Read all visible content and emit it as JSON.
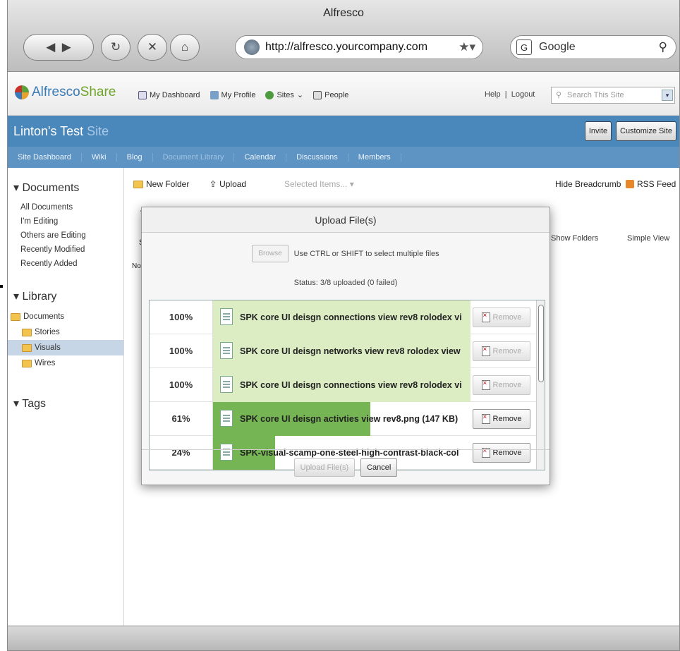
{
  "window": {
    "title": "Alfresco"
  },
  "browser": {
    "url": "http://alfresco.yourcompany.com",
    "search_engine_label": "G",
    "search_placeholder": "Google"
  },
  "app": {
    "logo_part1": "Alfresco ",
    "logo_part2": "Share",
    "top_links": [
      "My Dashboard",
      "My Profile",
      "Sites",
      "People"
    ],
    "help": "Help",
    "logout": "Logout",
    "site_search_placeholder": "Search This Site"
  },
  "site": {
    "title_main": "Linton's Test ",
    "title_suffix": "Site",
    "invite": "Invite",
    "customize": "Customize Site",
    "nav": [
      "Site Dashboard",
      "Wiki",
      "Blog",
      "Document Library",
      "Calendar",
      "Discussions",
      "Members"
    ],
    "active_nav": "Document Library"
  },
  "sidebar": {
    "documents_heading": "▾ Documents",
    "filters": [
      "All Documents",
      "I'm Editing",
      "Others are Editing",
      "Recently Modified",
      "Recently Added"
    ],
    "library_heading": "▾ Library",
    "tree": {
      "root": "Documents",
      "children": [
        "Stories",
        "Visuals",
        "Wires"
      ],
      "selected": "Visuals"
    },
    "tags_heading": "▾ Tags"
  },
  "toolbar": {
    "new_folder": "New Folder",
    "upload": "Upload",
    "selected_items": "Selected Items... ▾",
    "hide_breadcrumb": "Hide Breadcrumb",
    "rss_feed": "RSS Feed",
    "show_folders": "Show Folders",
    "simple_view": "Simple View"
  },
  "background_fragments": {
    "t": "t",
    "se": "Se",
    "no": "No it"
  },
  "dialog": {
    "title": "Upload File(s)",
    "browse": "Browse",
    "hint": "Use CTRL or SHIFT to select multiple files",
    "status": "Status: 3/8 uploaded (0 failed)",
    "files": [
      {
        "percent": "100%",
        "progress": 1.0,
        "name": "SPK core UI deisgn connections view rev8 rolodex vi",
        "remove": "Remove",
        "enabled": false
      },
      {
        "percent": "100%",
        "progress": 1.0,
        "name": "SPK core UI deisgn networks view rev8 rolodex view",
        "remove": "Remove",
        "enabled": false
      },
      {
        "percent": "100%",
        "progress": 1.0,
        "name": "SPK core UI deisgn connections view rev8 rolodex vi",
        "remove": "Remove",
        "enabled": false
      },
      {
        "percent": "61%",
        "progress": 0.61,
        "name": "SPK core UI deisgn activties view rev8.png (147 KB)",
        "remove": "Remove",
        "enabled": true
      },
      {
        "percent": "24%",
        "progress": 0.24,
        "name": "SPK-visual-scamp-one-steel-high-contrast-black-col",
        "remove": "Remove",
        "enabled": true
      }
    ],
    "upload_button": "Upload File(s)",
    "cancel_button": "Cancel"
  },
  "colors": {
    "complete_fill": "#dcedc4",
    "active_fill": "#76b553",
    "site_bar": "#4a87bb",
    "site_nav": "#5e94c3"
  }
}
